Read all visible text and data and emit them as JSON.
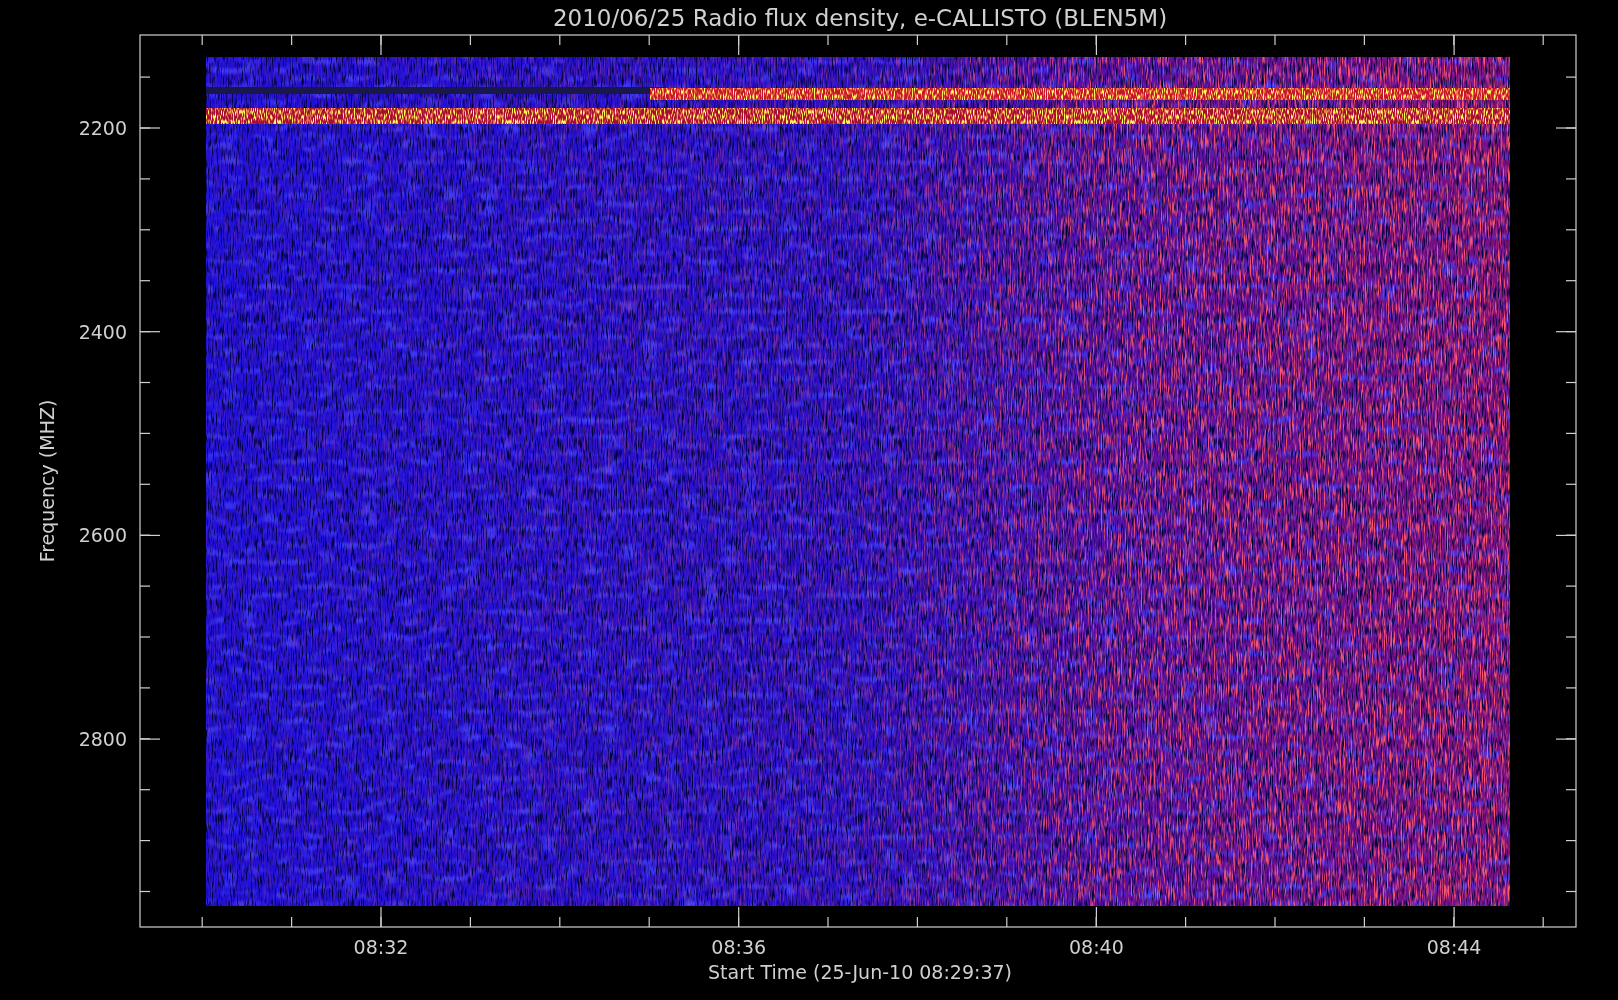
{
  "plot": {
    "title": "2010/06/25  Radio flux density, e-CALLISTO (BLEN5M)",
    "ylabel": "Frequency (MHZ)",
    "xlabel": "Start Time (25-Jun-10 08:29:37)",
    "yticks": [
      "2200",
      "2400",
      "2600",
      "2800"
    ],
    "xticks": [
      "08:32",
      "08:36",
      "08:40",
      "08:44"
    ]
  }
}
